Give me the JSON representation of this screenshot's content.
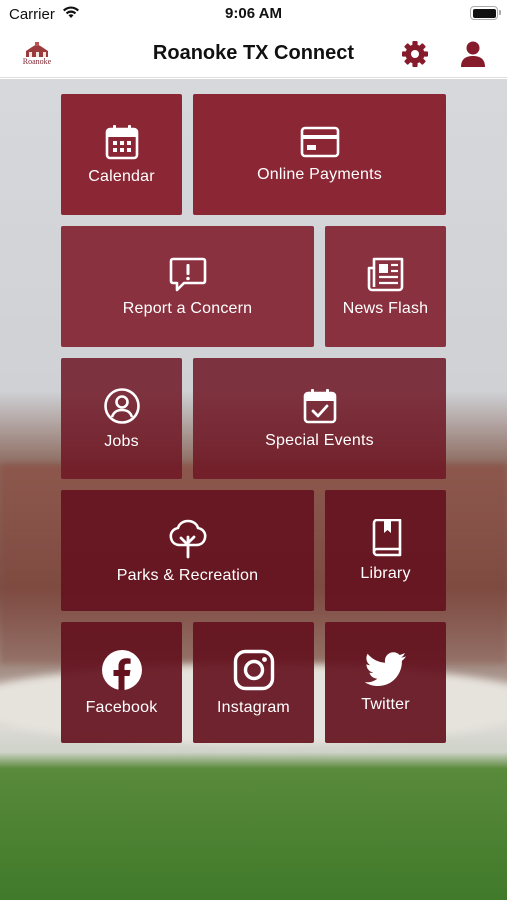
{
  "status_bar": {
    "carrier": "Carrier",
    "time": "9:06 AM"
  },
  "nav": {
    "title": "Roanoke TX Connect",
    "logo_text": "Roanoke"
  },
  "colors": {
    "brand": "#861b2b"
  },
  "tiles": [
    {
      "label": "Calendar",
      "icon": "calendar-icon"
    },
    {
      "label": "Online Payments",
      "icon": "credit-card-icon"
    },
    {
      "label": "Report a Concern",
      "icon": "alert-message-icon"
    },
    {
      "label": "News Flash",
      "icon": "newspaper-icon"
    },
    {
      "label": "Jobs",
      "icon": "user-circle-icon"
    },
    {
      "label": "Special Events",
      "icon": "calendar-check-icon"
    },
    {
      "label": "Parks & Recreation",
      "icon": "tree-icon"
    },
    {
      "label": "Library",
      "icon": "book-icon"
    },
    {
      "label": "Facebook",
      "icon": "facebook-icon"
    },
    {
      "label": "Instagram",
      "icon": "instagram-icon"
    },
    {
      "label": "Twitter",
      "icon": "twitter-icon"
    }
  ]
}
